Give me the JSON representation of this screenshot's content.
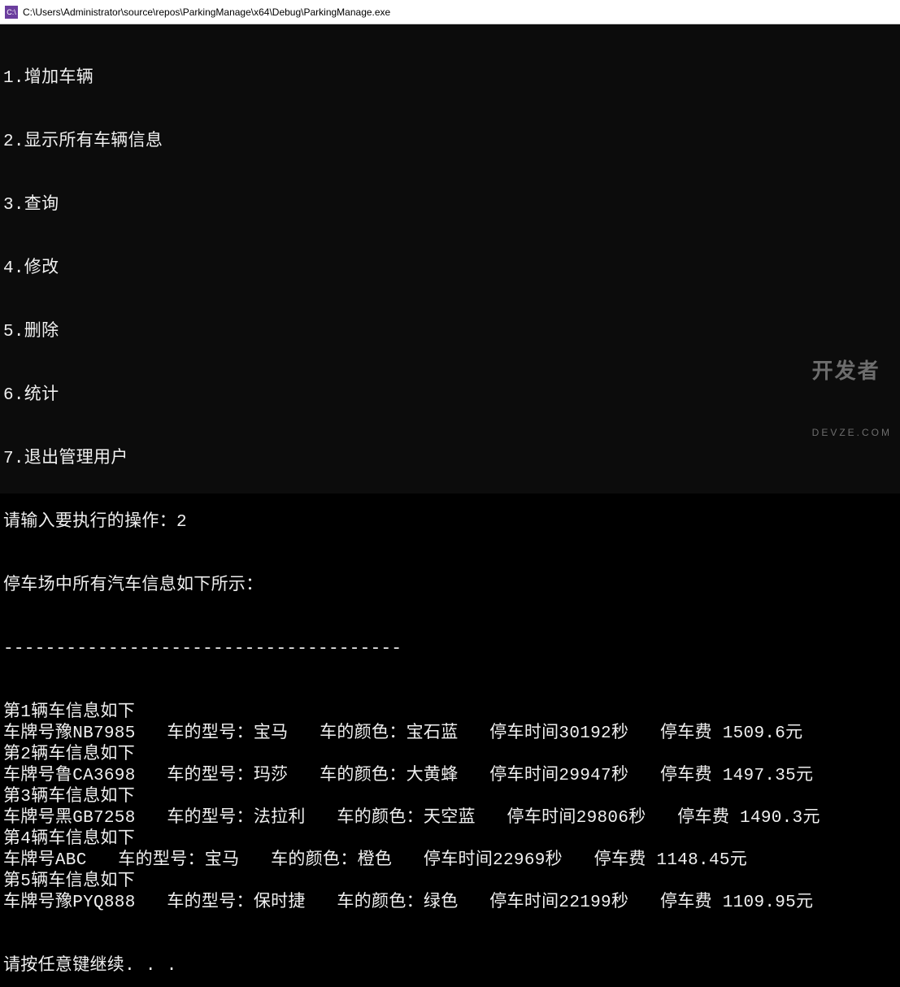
{
  "window": {
    "icon_label": "C:\\",
    "title": "C:\\Users\\Administrator\\source\\repos\\ParkingManage\\x64\\Debug\\ParkingManage.exe"
  },
  "menu": {
    "items": [
      "1.增加车辆",
      "2.显示所有车辆信息",
      "3.查询",
      "4.修改",
      "5.删除",
      "6.统计",
      "7.退出管理用户"
    ],
    "prompt_label": "请输入要执行的操作：",
    "prompt_input": "2"
  },
  "output": {
    "header": "停车场中所有汽车信息如下所示：",
    "separator": "--------------------------------------",
    "cars": [
      {
        "index_line": "第1辆车信息如下",
        "plate": "豫NB7985",
        "model": "宝马",
        "color": "宝石蓝",
        "seconds": "30192",
        "fee": "1509.6"
      },
      {
        "index_line": "第2辆车信息如下",
        "plate": "鲁CA3698",
        "model": "玛莎",
        "color": "大黄蜂",
        "seconds": "29947",
        "fee": "1497.35"
      },
      {
        "index_line": "第3辆车信息如下",
        "plate": "黑GB7258",
        "model": "法拉利",
        "color": "天空蓝",
        "seconds": "29806",
        "fee": "1490.3"
      },
      {
        "index_line": "第4辆车信息如下",
        "plate": "ABC",
        "model": "宝马",
        "color": "橙色",
        "seconds": "22969",
        "fee": "1148.45"
      },
      {
        "index_line": "第5辆车信息如下",
        "plate": "豫PYQ888",
        "model": "保时捷",
        "color": "绿色",
        "seconds": "22199",
        "fee": "1109.95"
      }
    ],
    "labels": {
      "plate_prefix": "车牌号",
      "model_prefix": "车的型号：",
      "color_prefix": "车的颜色：",
      "time_prefix": "停车时间",
      "time_suffix": "秒",
      "fee_prefix": "停车费 ",
      "fee_suffix": "元"
    },
    "continue_prompt": "请按任意键继续. . ."
  },
  "watermark": {
    "main": "开发者",
    "sub": "DEVZE.COM"
  }
}
